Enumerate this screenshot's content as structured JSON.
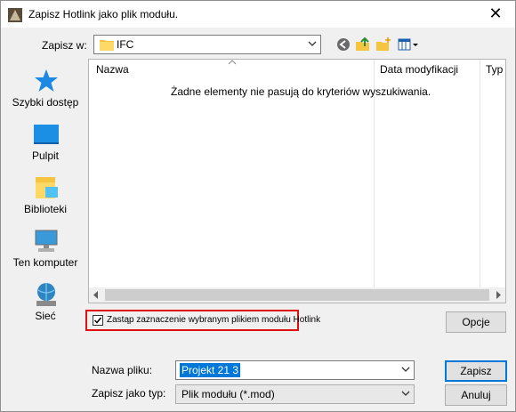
{
  "window": {
    "title": "Zapisz Hotlink jako plik modułu.",
    "close_glyph": "✕"
  },
  "location": {
    "label": "Zapisz w:",
    "folder": "IFC"
  },
  "toolbar": {
    "icons": [
      "back-icon",
      "up-folder-icon",
      "new-folder-icon",
      "view-menu-icon"
    ]
  },
  "sidebar": {
    "items": [
      {
        "label": "Szybki dostęp",
        "icon": "star-icon"
      },
      {
        "label": "Pulpit",
        "icon": "desktop-icon"
      },
      {
        "label": "Biblioteki",
        "icon": "libraries-icon"
      },
      {
        "label": "Ten komputer",
        "icon": "computer-icon"
      },
      {
        "label": "Sieć",
        "icon": "network-icon"
      }
    ]
  },
  "file_list": {
    "columns": [
      "Nazwa",
      "Data modyfikacji",
      "Typ"
    ],
    "empty_message": "Żadne elementy nie pasują do kryteriów wyszukiwania."
  },
  "options": {
    "checkbox_label": "Zastąp zaznaczenie wybranym plikiem modułu Hotlink",
    "checked": true,
    "button": "Opcje"
  },
  "filename": {
    "label": "Nazwa pliku:",
    "value": "Projekt 21 3"
  },
  "filetype": {
    "label": "Zapisz jako typ:",
    "value": "Plik modułu (*.mod)"
  },
  "actions": {
    "save": "Zapisz",
    "cancel": "Anuluj"
  },
  "colors": {
    "highlight": "#e01010",
    "selection": "#0078d7",
    "accent_star": "#1e88e5"
  }
}
